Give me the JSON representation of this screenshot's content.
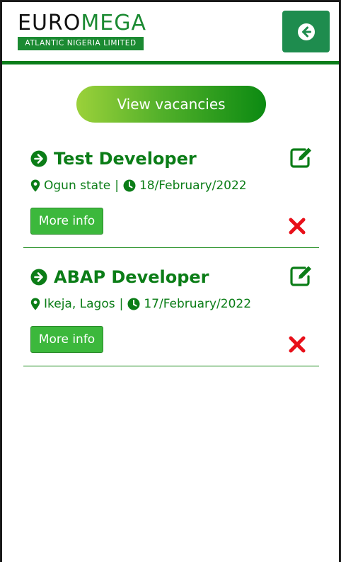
{
  "brand": {
    "logo_euro": "EURO",
    "logo_mega": "MEGA",
    "logo_subtitle": "ATLANTIC NIGERIA LIMITED",
    "primary_green": "#0b7d17",
    "accent_green": "#1b8a32"
  },
  "header": {
    "back_icon": "arrow-left-circle-icon"
  },
  "actions": {
    "view_vacancies_label": "View vacancies"
  },
  "jobs": [
    {
      "title": "Test Developer",
      "location": "Ogun state",
      "separator": "|",
      "date": "18/February/2022",
      "more_info_label": "More info"
    },
    {
      "title": "ABAP Developer",
      "location": "Ikeja, Lagos",
      "separator": "|",
      "date": "17/February/2022",
      "more_info_label": "More info"
    }
  ]
}
